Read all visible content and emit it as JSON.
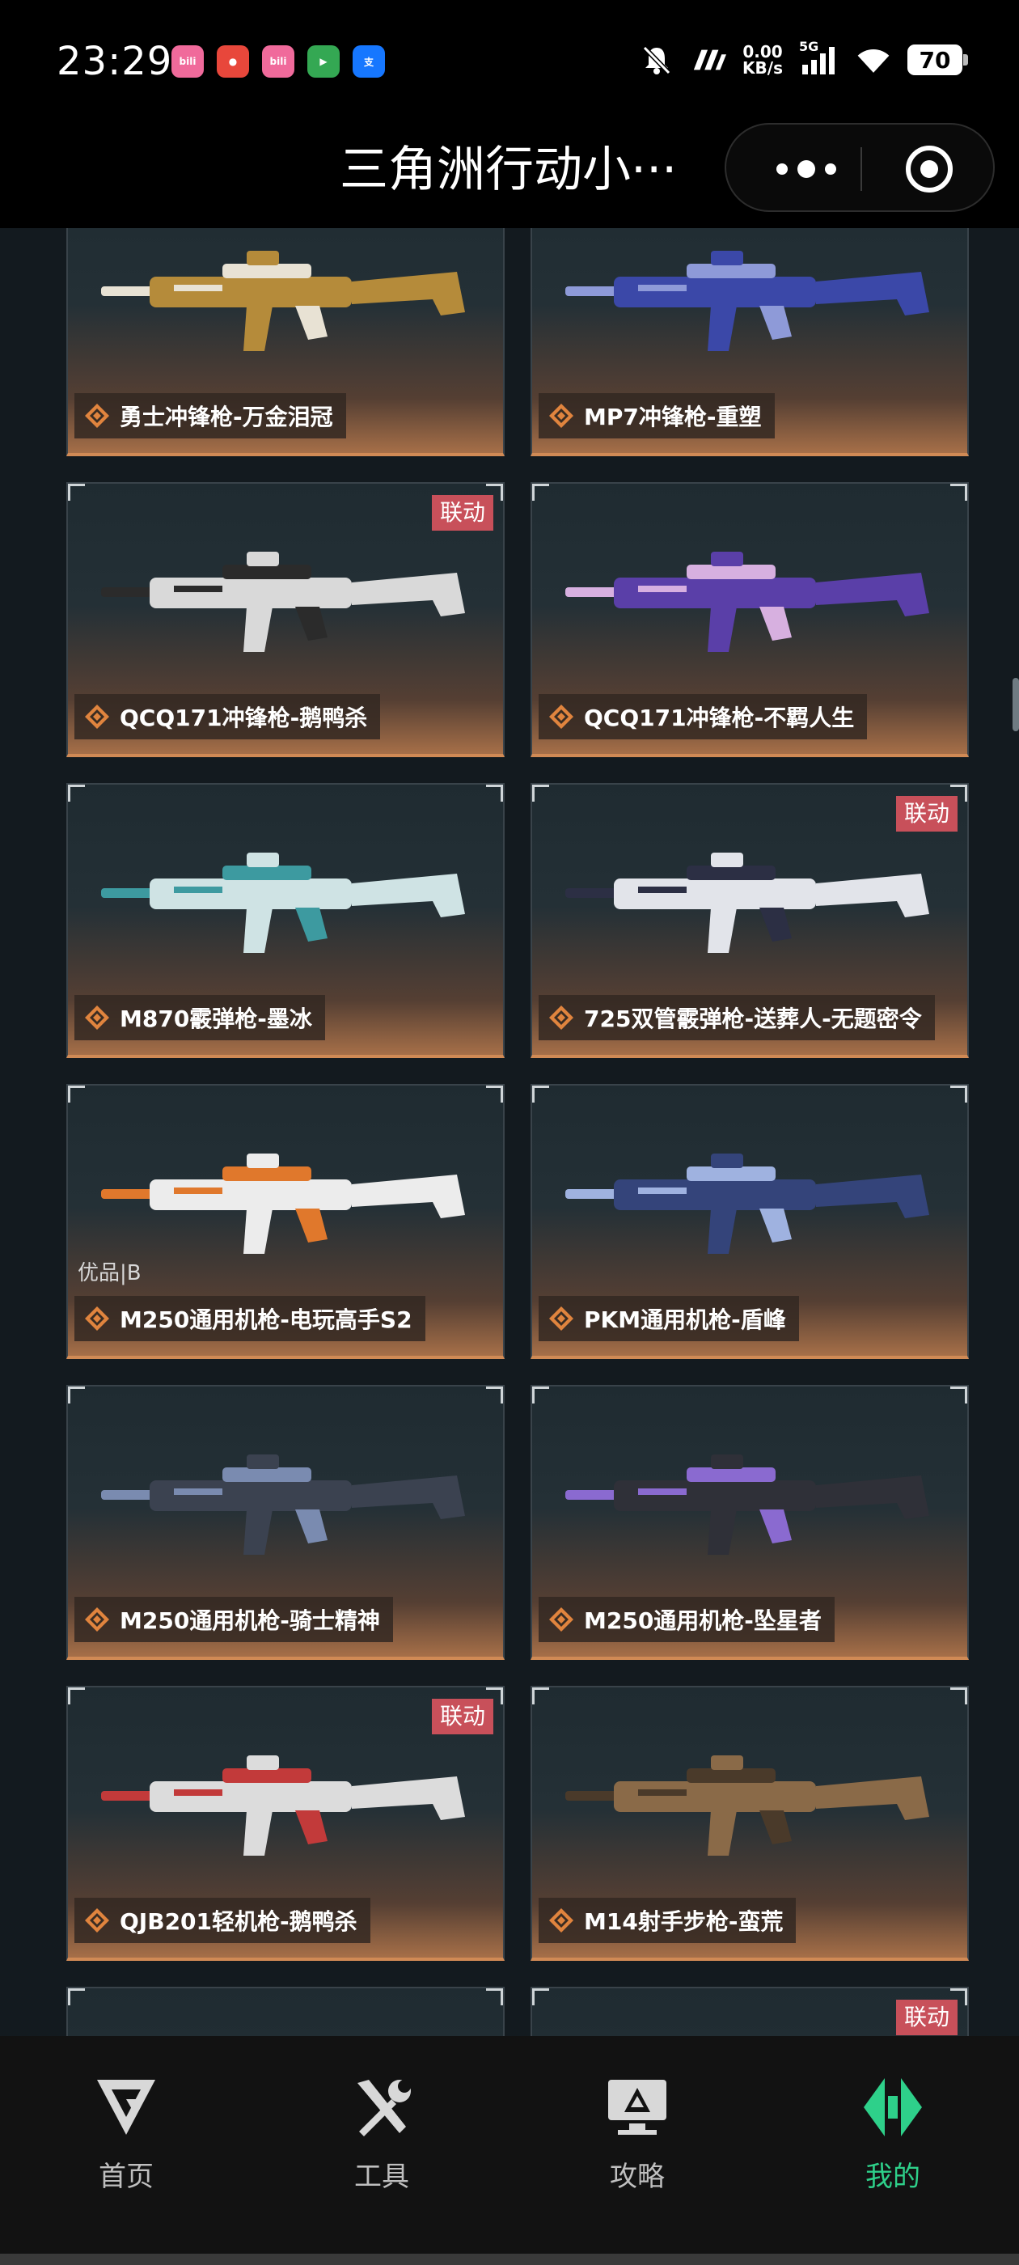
{
  "status_bar": {
    "time": "23:29",
    "apps": [
      {
        "icon": "bilibili-icon",
        "text": "bili",
        "color": "#f06a9b"
      },
      {
        "icon": "xiaohongshu-icon",
        "text": "●",
        "color": "#e8473b"
      },
      {
        "icon": "bilibili-icon",
        "text": "bili",
        "color": "#f06a9b"
      },
      {
        "icon": "play-store-icon",
        "text": "▶",
        "color": "#34a853"
      },
      {
        "icon": "alipay-icon",
        "text": "支",
        "color": "#1677ff"
      }
    ],
    "net_speed_value": "0.00",
    "net_speed_unit": "KB/s",
    "network": "5G",
    "battery": "70"
  },
  "header": {
    "title": "三角洲行动小···"
  },
  "cards": [
    {
      "label": "勇士冲锋枪-万金泪冠",
      "gun_color": "#b58b3a",
      "accent": "#e8e2d4"
    },
    {
      "label": "MP7冲锋枪-重塑",
      "gun_color": "#3b48a8",
      "accent": "#8e9ad8"
    },
    {
      "label": "QCQ171冲锋枪-鹅鸭杀",
      "badge": "联动",
      "gun_color": "#d9d9d9",
      "accent": "#2b2b2b"
    },
    {
      "label": "QCQ171冲锋枪-不羁人生",
      "gun_color": "#5a3fa8",
      "accent": "#d7b0e0"
    },
    {
      "label": "M870霰弹枪-墨冰",
      "gun_color": "#cfe3e4",
      "accent": "#3d9aa0"
    },
    {
      "label": "725双管霰弹枪-送葬人-无题密令",
      "badge": "联动",
      "gun_color": "#e2e4ea",
      "accent": "#2c2f44"
    },
    {
      "label": "M250通用机枪-电玩高手S2",
      "quality": "优品|B",
      "gun_color": "#ececec",
      "accent": "#e0782c"
    },
    {
      "label": "PKM通用机枪-盾峰",
      "gun_color": "#34447a",
      "accent": "#9fb2e0"
    },
    {
      "label": "M250通用机枪-骑士精神",
      "gun_color": "#3b4250",
      "accent": "#7a8bb0"
    },
    {
      "label": "M250通用机枪-坠星者",
      "gun_color": "#2f3038",
      "accent": "#8a6ad0"
    },
    {
      "label": "QJB201轻机枪-鹅鸭杀",
      "badge": "联动",
      "gun_color": "#dcdcdc",
      "accent": "#c23a3a"
    },
    {
      "label": "M14射手步枪-蛮荒",
      "gun_color": "#8a6a48",
      "accent": "#4a3a2a"
    },
    {
      "label": "",
      "gun_color": "#8a6a48",
      "accent": "#4a3a2a"
    },
    {
      "label": "",
      "badge": "联动",
      "gun_color": "#8a6a48",
      "accent": "#4a3a2a"
    }
  ],
  "tabs": [
    {
      "label": "首页",
      "icon": "home-logo-icon",
      "active": false
    },
    {
      "label": "工具",
      "icon": "tools-icon",
      "active": false
    },
    {
      "label": "攻略",
      "icon": "guide-monitor-icon",
      "active": false
    },
    {
      "label": "我的",
      "icon": "profile-logo-icon",
      "active": true
    }
  ],
  "colors": {
    "active_tab": "#2ed08a",
    "badge": "#c8505a",
    "card_accent": "#d08a55"
  }
}
